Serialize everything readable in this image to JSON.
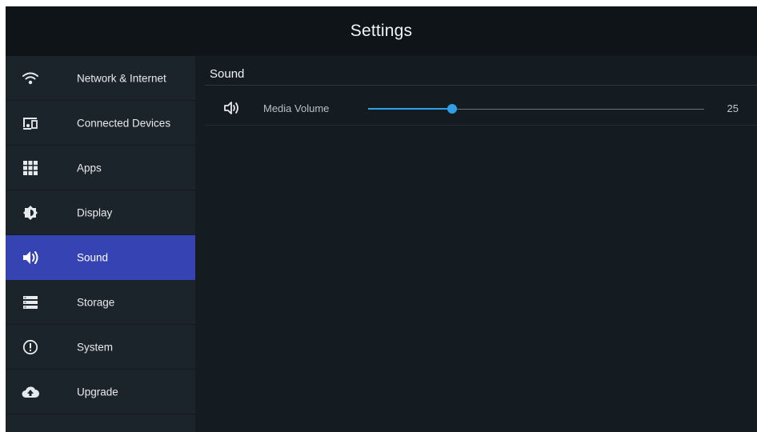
{
  "header": {
    "title": "Settings"
  },
  "sidebar": {
    "items": [
      {
        "label": "Network & Internet",
        "icon": "wifi-icon",
        "active": false
      },
      {
        "label": "Connected Devices",
        "icon": "devices-icon",
        "active": false
      },
      {
        "label": "Apps",
        "icon": "apps-grid-icon",
        "active": false
      },
      {
        "label": "Display",
        "icon": "brightness-icon",
        "active": false
      },
      {
        "label": "Sound",
        "icon": "speaker-icon",
        "active": true
      },
      {
        "label": "Storage",
        "icon": "storage-icon",
        "active": false
      },
      {
        "label": "System",
        "icon": "alert-circle-icon",
        "active": false
      },
      {
        "label": "Upgrade",
        "icon": "cloud-upload-icon",
        "active": false
      }
    ]
  },
  "content": {
    "section_title": "Sound",
    "media_volume": {
      "label": "Media Volume",
      "icon": "volume-icon",
      "value": "25",
      "fraction": 0.25
    }
  },
  "colors": {
    "accent": "#2fa0e6",
    "active_item": "#3644b3",
    "header_bg": "#0f1418",
    "sidebar_bg": "#1c242b",
    "content_bg": "#141b21"
  }
}
